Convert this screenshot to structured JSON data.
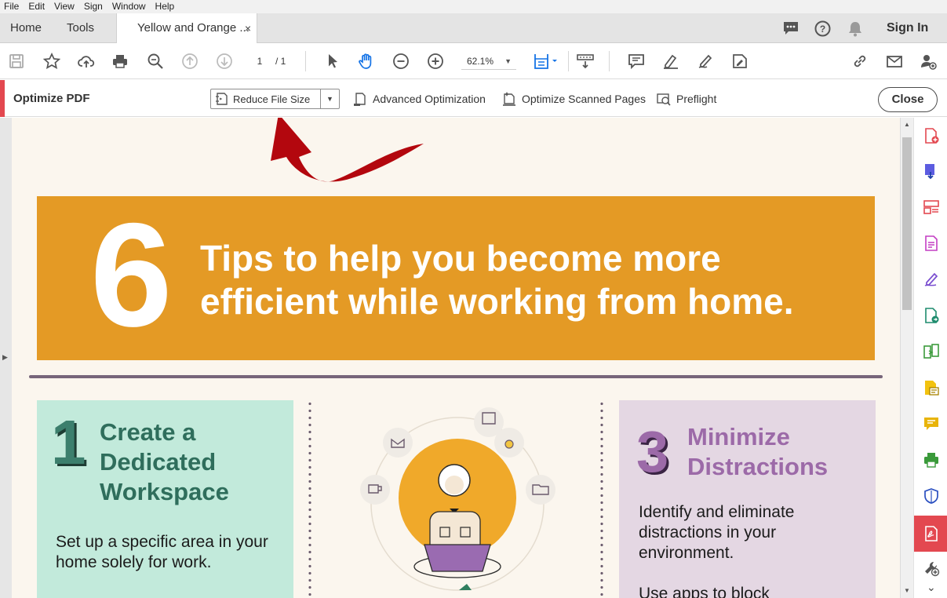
{
  "menu": [
    "File",
    "Edit",
    "View",
    "Sign",
    "Window",
    "Help"
  ],
  "tabs": {
    "home": "Home",
    "tools": "Tools",
    "doc": "Yellow and Orange ...",
    "close": "×"
  },
  "header": {
    "signin": "Sign In"
  },
  "toolbar": {
    "page_current": "1",
    "page_total": "/ 1",
    "zoom": "62.1%"
  },
  "optimize": {
    "title": "Optimize PDF",
    "reduce": "Reduce File Size",
    "advanced": "Advanced Optimization",
    "scanned": "Optimize Scanned Pages",
    "preflight": "Preflight",
    "close": "Close"
  },
  "doc": {
    "banner_number": "6",
    "banner_line1": "Tips to help you become more",
    "banner_line2": "efficient while working from home.",
    "card1_number": "1",
    "card1_title": [
      "Create a",
      "Dedicated",
      "Workspace"
    ],
    "card1_body": "Set up a specific area in your home solely for work.",
    "card3_number": "3",
    "card3_title": [
      "Minimize",
      "Distractions"
    ],
    "card3_body": "Identify and eliminate distractions in your environment.",
    "card3_body2": "Use apps to block"
  },
  "colors": {
    "banner": "#e49a25",
    "card1": "#c2eadb",
    "card3": "#e4d7e3",
    "page_bg": "#fbf6ee",
    "accent_red": "#e34850"
  }
}
